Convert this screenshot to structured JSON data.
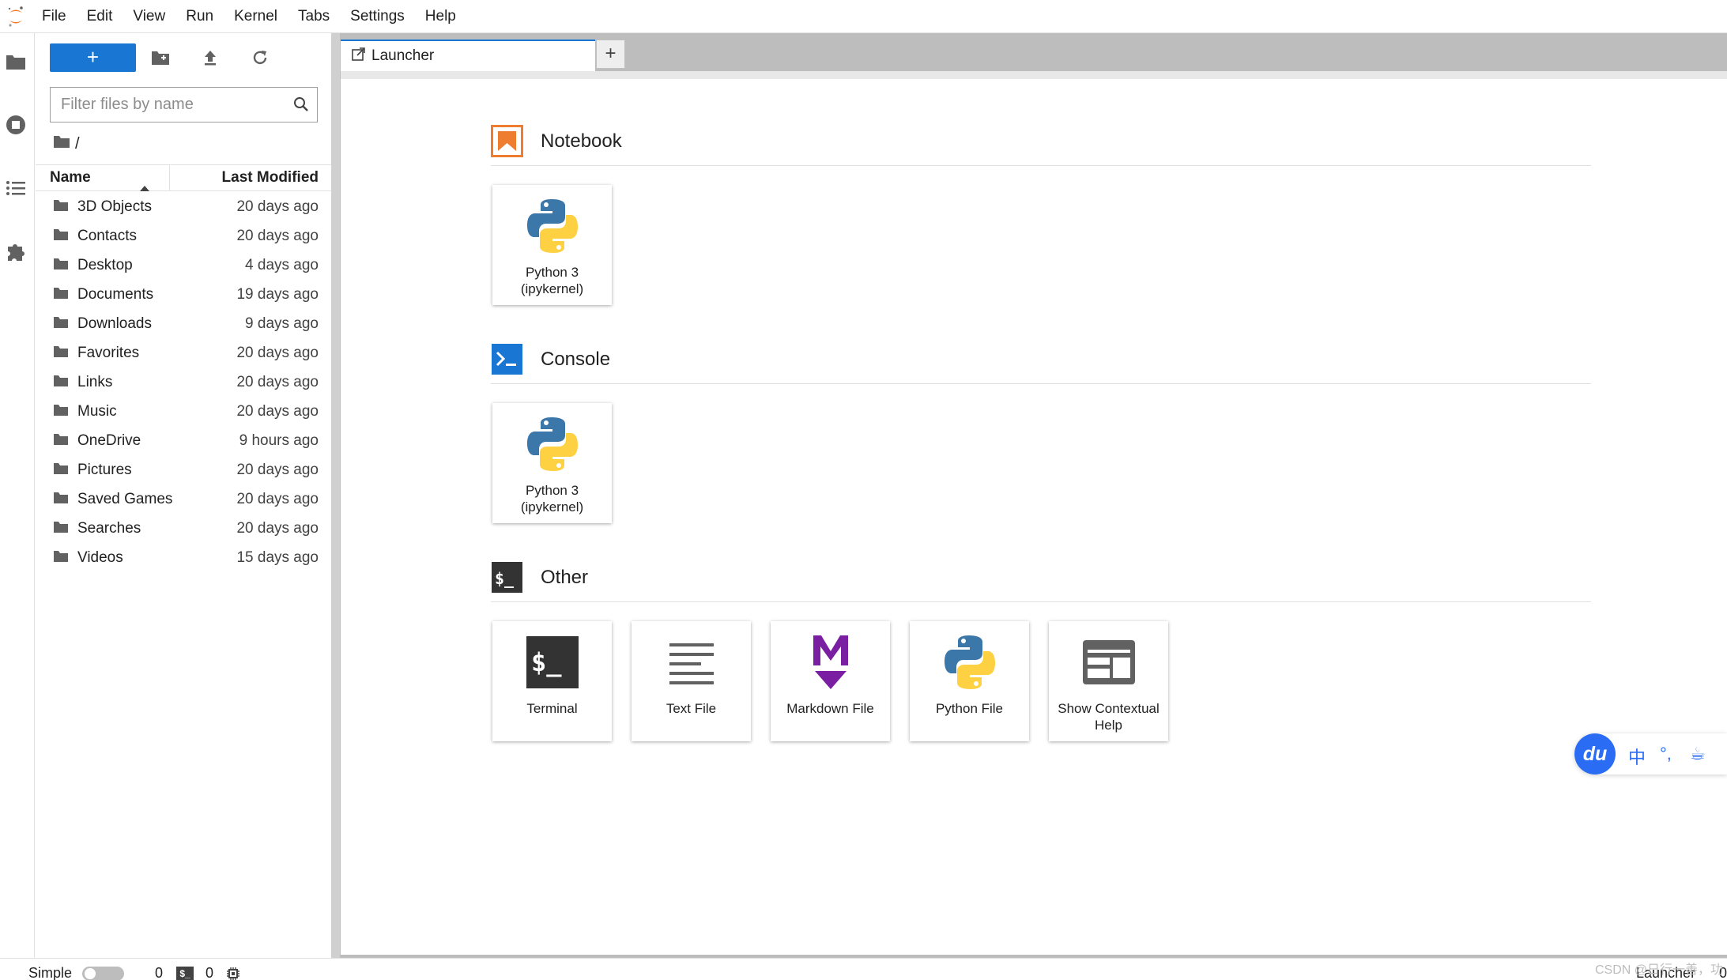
{
  "menubar": {
    "items": [
      "File",
      "Edit",
      "View",
      "Run",
      "Kernel",
      "Tabs",
      "Settings",
      "Help"
    ]
  },
  "leftbar": {
    "icons": [
      "folder-icon",
      "running-icon",
      "toc-icon",
      "extension-icon"
    ]
  },
  "filebrowser": {
    "new_button_label": "+",
    "filter_placeholder": "Filter files by name",
    "breadcrumb": "/",
    "columns": {
      "name": "Name",
      "modified": "Last Modified"
    },
    "items": [
      {
        "name": "3D Objects",
        "modified": "20 days ago"
      },
      {
        "name": "Contacts",
        "modified": "20 days ago"
      },
      {
        "name": "Desktop",
        "modified": "4 days ago"
      },
      {
        "name": "Documents",
        "modified": "19 days ago"
      },
      {
        "name": "Downloads",
        "modified": "9 days ago"
      },
      {
        "name": "Favorites",
        "modified": "20 days ago"
      },
      {
        "name": "Links",
        "modified": "20 days ago"
      },
      {
        "name": "Music",
        "modified": "20 days ago"
      },
      {
        "name": "OneDrive",
        "modified": "9 hours ago"
      },
      {
        "name": "Pictures",
        "modified": "20 days ago"
      },
      {
        "name": "Saved Games",
        "modified": "20 days ago"
      },
      {
        "name": "Searches",
        "modified": "20 days ago"
      },
      {
        "name": "Videos",
        "modified": "15 days ago"
      }
    ]
  },
  "tabs": {
    "active_label": "Launcher",
    "add_label": "+"
  },
  "launcher": {
    "sections": [
      {
        "title": "Notebook",
        "cards": [
          {
            "label": "Python 3 (ipykernel)"
          }
        ]
      },
      {
        "title": "Console",
        "cards": [
          {
            "label": "Python 3 (ipykernel)"
          }
        ]
      },
      {
        "title": "Other",
        "cards": [
          {
            "label": "Terminal"
          },
          {
            "label": "Text File"
          },
          {
            "label": "Markdown File"
          },
          {
            "label": "Python File"
          },
          {
            "label": "Show Contextual Help"
          }
        ]
      }
    ]
  },
  "ime": {
    "logo": "du",
    "lang": "中",
    "punct": "°,",
    "cup": "☕"
  },
  "statusbar": {
    "mode_label": "Simple",
    "kernels_count": "0",
    "terminals_count": "0",
    "terminal_badge": "$_",
    "right_label": "Launcher",
    "right_count": "0"
  },
  "watermark": "CSDN @日行一善，功不唐捐"
}
